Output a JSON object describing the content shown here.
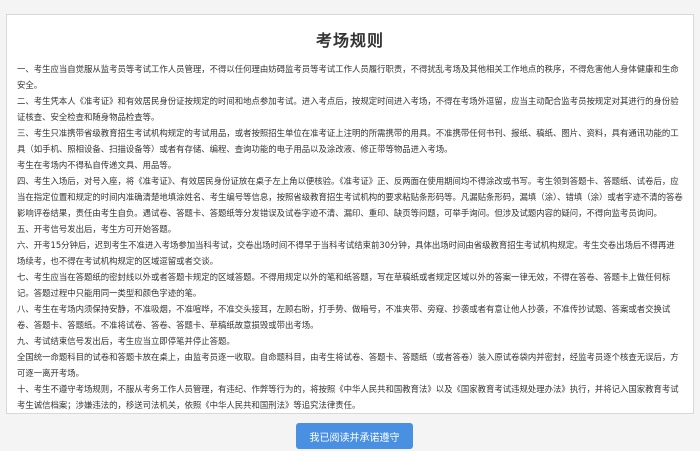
{
  "title": "考场规则",
  "rules": [
    "一、考生应当自觉服从监考员等考试工作人员管理，不得以任何理由妨碍监考员等考试工作人员履行职责，不得扰乱考场及其他相关工作地点的秩序，不得危害他人身体健康和生命安全。",
    "二、考生凭本人《准考证》和有效居民身份证按规定的时间和地点参加考试。进入考点后，按规定时间进入考场，不得在考场外逗留，应当主动配合监考员按规定对其进行的身份验证核查、安全检查和随身物品检查等。",
    "三、考生只准携带省级教育招生考试机构规定的考试用品，或者按照招生单位在准考证上注明的所需携带的用具。不准携带任何书刊、报纸、稿纸、图片、资料，具有通讯功能的工具（如手机、照相设备、扫描设备等）或者有存储、编程、查询功能的电子用品以及涂改液、修正带等物品进入考场。",
    "考生在考场内不得私自传递文具、用品等。",
    "四、考生入场后，对号入座，将《准考证》、有效居民身份证放在桌子左上角以便核验。《准考证》正、反两面在使用期间均不得涂改或书写。考生领到答题卡、答题纸、试卷后，应当在指定位置和规定的时间内准确清楚地填涂姓名、考生编号等信息，按照省级教育招生考试机构的要求粘贴条形码等。凡漏贴条形码，漏填（涂）、错填（涂）或者字迹不清的答卷影响评卷结果，责任由考生自负。遇试卷、答题卡、答题纸等分发错误及试卷字迹不清、漏印、重印、缺页等问题，可举手询问。但涉及试题内容的疑问，不得向监考员询问。",
    "五、开考信号发出后，考生方可开始答题。",
    "六、开考15分钟后，迟到考生不准进入考场参加当科考试，交卷出场时间不得早于当科考试结束前30分钟，具体出场时间由省级教育招生考试机构规定。考生交卷出场后不得再进场续考，也不得在考试机构规定的区域逗留或者交谈。",
    "七、考生应当在答题纸的密封线以外或者答题卡规定的区域答题。不得用规定以外的笔和纸答题，写在草稿纸或者规定区域以外的答案一律无效，不得在答卷、答题卡上做任何标记。答题过程中只能用同一类型和颜色字迹的笔。",
    "八、考生在考场内须保持安静，不准吸烟，不准喧哗，不准交头接耳，左顾右盼，打手势、做暗号，不准夹带、旁窥、抄袭或者有意让他人抄袭，不准传抄试题、答案或者交换试卷、答题卡、答题纸。不准将试卷、答卷、答题卡、草稿纸故意损毁或带出考场。",
    "九、考试结束信号发出后，考生应当立即停笔并停止答题。",
    "全国统一命题科目的试卷和答题卡放在桌上，由监考员逐一收取。自命题科目，由考生将试卷、答题卡、答题纸（或者答卷）装入原试卷袋内并密封，经监考员逐个核查无误后，方可逐一离开考场。",
    "十、考生不遵守考场规则，不服从考务工作人员管理，有违纪、作弊等行为的，将按照《中华人民共和国教育法》以及《国家教育考试违规处理办法》执行，并将记入国家教育考试考生诚信档案；涉嫌违法的，移送司法机关，依照《中华人民共和国刑法》等追究法律责任。"
  ],
  "confirm_button": "我已阅读并承诺遵守",
  "colors": {
    "accent": "#4a90e2",
    "text": "#333333",
    "border": "#d8d8d8"
  }
}
